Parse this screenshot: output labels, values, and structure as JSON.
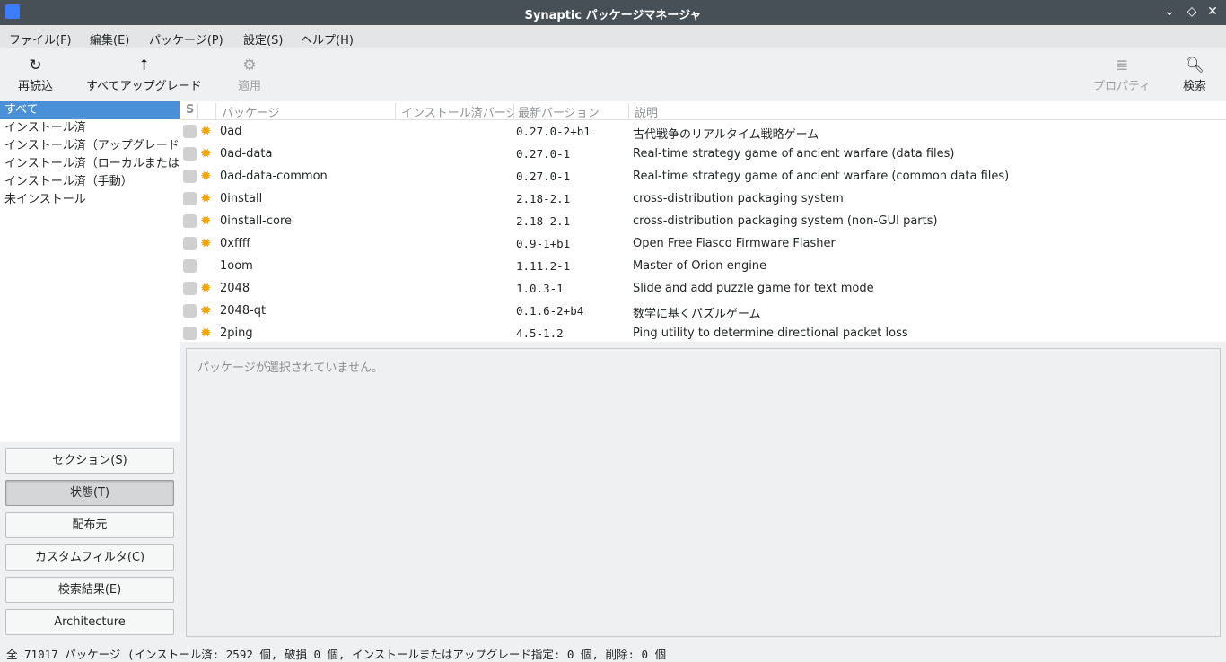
{
  "window": {
    "title": "Synaptic パッケージマネージャ"
  },
  "menu": [
    "ファイル(F)",
    "編集(E)",
    "パッケージ(P)",
    "設定(S)",
    "ヘルプ(H)"
  ],
  "toolbar": {
    "reload": "再読込",
    "upgrade_all": "すべてアップグレード",
    "apply": "適用",
    "properties": "プロパティ",
    "search": "検索"
  },
  "sidebar": {
    "items": [
      "すべて",
      "インストール済",
      "インストール済（アップグレード可能）",
      "インストール済（ローカルまたは廃止）",
      "インストール済（手動）",
      "未インストール"
    ],
    "buttons": [
      "セクション(S)",
      "状態(T)",
      "配布元",
      "カスタムフィルタ(C)",
      "検索結果(E)",
      "Architecture"
    ]
  },
  "columns": [
    "S",
    "",
    "パッケージ",
    "インストール済バージョン",
    "最新バージョン",
    "説明"
  ],
  "packages": [
    {
      "name": "0ad",
      "latest": "0.27.0-2+b1",
      "desc": "古代戦争のリアルタイム戦略ゲーム",
      "badge": true
    },
    {
      "name": "0ad-data",
      "latest": "0.27.0-1",
      "desc": "Real-time strategy game of ancient warfare (data files)",
      "badge": true
    },
    {
      "name": "0ad-data-common",
      "latest": "0.27.0-1",
      "desc": "Real-time strategy game of ancient warfare (common data files)",
      "badge": true
    },
    {
      "name": "0install",
      "latest": "2.18-2.1",
      "desc": "cross-distribution packaging system",
      "badge": true
    },
    {
      "name": "0install-core",
      "latest": "2.18-2.1",
      "desc": "cross-distribution packaging system (non-GUI parts)",
      "badge": true
    },
    {
      "name": "0xffff",
      "latest": "0.9-1+b1",
      "desc": "Open Free Fiasco Firmware Flasher",
      "badge": true
    },
    {
      "name": "1oom",
      "latest": "1.11.2-1",
      "desc": "Master of Orion engine",
      "badge": false
    },
    {
      "name": "2048",
      "latest": "1.0.3-1",
      "desc": "Slide and add puzzle game for text mode",
      "badge": true
    },
    {
      "name": "2048-qt",
      "latest": "0.1.6-2+b4",
      "desc": "数学に基くパズルゲーム",
      "badge": true
    },
    {
      "name": "2ping",
      "latest": "4.5-1.2",
      "desc": "Ping utility to determine directional packet loss",
      "badge": true
    }
  ],
  "detail": {
    "empty": "パッケージが選択されていません。"
  },
  "status": "全 71017 パッケージ (インストール済: 2592 個, 破損 0 個, インストールまたはアップグレード指定: 0 個, 削除: 0 個"
}
